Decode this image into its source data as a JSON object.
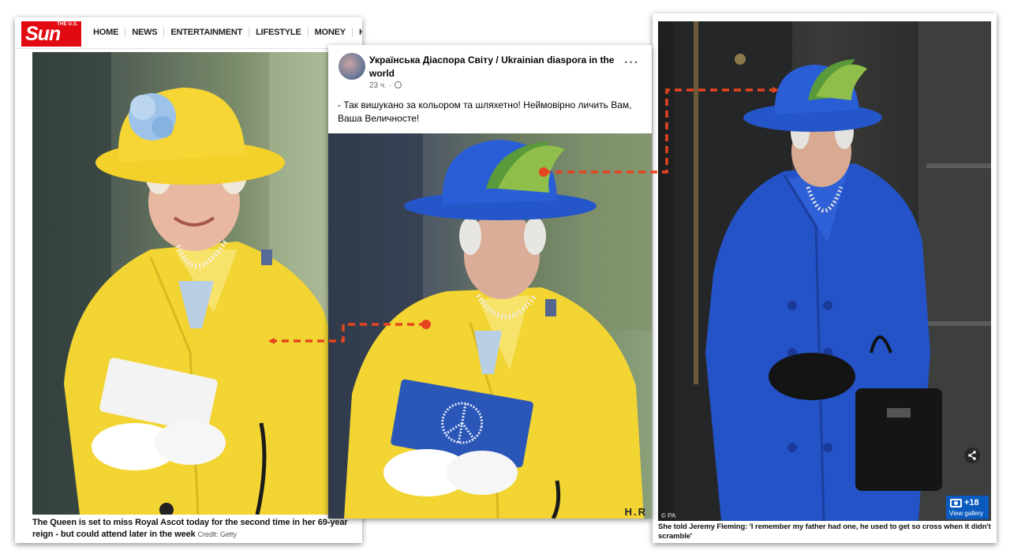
{
  "sun": {
    "logo_top": "THE U.S.",
    "logo_main": "Sun",
    "nav": [
      "HOME",
      "NEWS",
      "ENTERTAINMENT",
      "LIFESTYLE",
      "MONEY",
      "HEALTH"
    ],
    "caption": "The Queen is set to miss Royal Ascot today for the second time in her 69-year reign - but could attend later in the week",
    "credit": "Credit: Getty"
  },
  "facebook": {
    "page_name": "Українська Діаспора Світу / Ukrainian diaspora in the world",
    "time": "23 ч. ·",
    "more": "···",
    "post_text": "- Так вишукано за кольором та шляхетно! Неймовірно личить Вам, Ваша Величносте!",
    "watermark": "H.R"
  },
  "dailymail": {
    "photo_credit": "© PA",
    "share_icon": "<",
    "gallery_count": "+18",
    "gallery_label": "View gallery",
    "caption": "She told Jeremy Fleming: 'I remember my father had one, he used to get so cross when it didn't scramble'"
  },
  "colors": {
    "arrow": "#e5441f",
    "sun_red": "#e20a12",
    "gallery_blue": "#0b5bbf",
    "coat_yellow": "#f2d532",
    "coat_blue": "#2453c8"
  }
}
